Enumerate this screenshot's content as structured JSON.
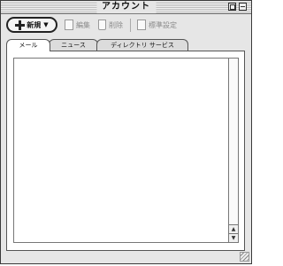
{
  "window": {
    "title": "アカウント"
  },
  "toolbar": {
    "new_label": "新規",
    "edit_label": "編集",
    "delete_label": "削除",
    "default_label": "標準設定"
  },
  "tabs": [
    {
      "label": "メール"
    },
    {
      "label": "ニュース"
    },
    {
      "label": "ディレクトリ サービス"
    }
  ],
  "icons": {
    "new": "plus-icon",
    "edit": "edit-icon",
    "delete": "trash-icon",
    "default": "default-icon"
  }
}
